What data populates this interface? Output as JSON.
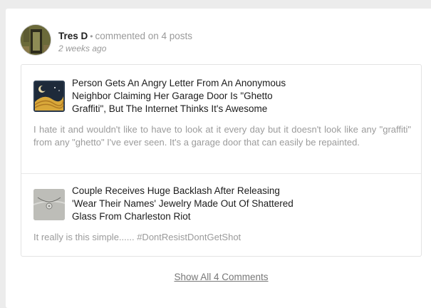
{
  "user": {
    "name": "Tres D",
    "activity": "commented on 4 posts",
    "timestamp": "2 weeks ago"
  },
  "comments": [
    {
      "post_title": "Person Gets An Angry Letter From An Anonymous Neighbor Claiming Her Garage Door Is \"Ghetto Graffiti\", But The Internet Thinks It's Awesome",
      "comment": "I hate it and wouldn't like to have to look at it every day but it doesn't look like any \"graffiti\" from any \"ghetto\" I've ever seen. It's a garage door that can easily be repainted."
    },
    {
      "post_title": "Couple Receives Huge Backlash After Releasing 'Wear Their Names' Jewelry Made Out Of Shattered Glass From Charleston Riot",
      "comment": "It really is this simple...... #DontResistDontGetShot"
    }
  ],
  "show_all_label": "Show All 4 Comments",
  "colors": {
    "background": "#ececec",
    "card": "#ffffff",
    "title_text": "#1c1c1c",
    "muted_text": "#9b9b9b"
  }
}
